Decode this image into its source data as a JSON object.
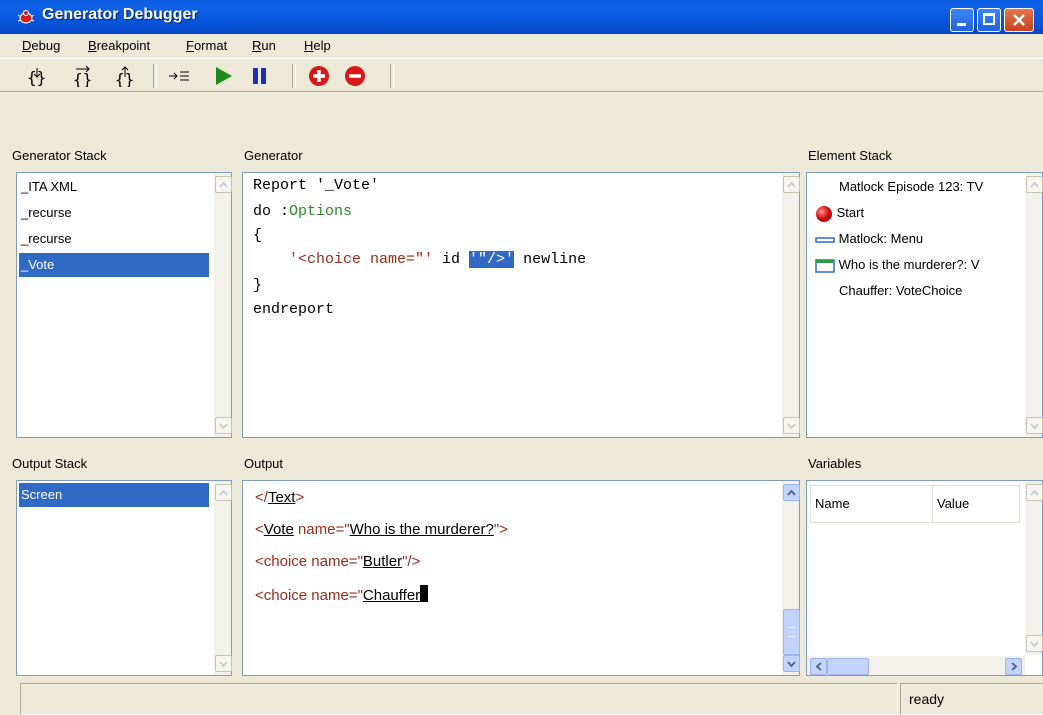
{
  "window": {
    "title": "Generator Debugger"
  },
  "menu": [
    "Debug",
    "Breakpoint",
    "Format",
    "Run",
    "Help"
  ],
  "toolbar": {
    "buttons": [
      "step-into-icon",
      "step-over-icon",
      "step-out-icon",
      "run-to-cursor-icon",
      "run-icon",
      "pause-icon",
      "add-breakpoint-icon",
      "remove-breakpoint-icon"
    ]
  },
  "generator_stack": {
    "label": "Generator Stack",
    "items": [
      "_ITA XML",
      "_recurse",
      "_recurse",
      "_Vote"
    ],
    "selected": "_Vote"
  },
  "generator": {
    "label": "Generator",
    "lines": {
      "l1": "Report '_Vote'",
      "l2a": "do :",
      "l2b": "Options",
      "l3": "{",
      "l4a": "'<choice name=\"'",
      "l4b": " id ",
      "l4c": "'\"/>'",
      "l4d": " newline",
      "l5": "}",
      "l6": "endreport"
    }
  },
  "element_stack": {
    "label": "Element Stack",
    "items": [
      "Matlock Episode 123: TV",
      "Start",
      "Matlock: Menu",
      "Who is the murderer?: V",
      "Chauffer: VoteChoice"
    ]
  },
  "output_stack": {
    "label": "Output Stack",
    "items": [
      "Screen"
    ],
    "selected": "Screen"
  },
  "output": {
    "label": "Output",
    "l1a": "</",
    "l1b": "Text",
    "l1c": ">",
    "l2a": "<",
    "l2b": "Vote",
    "l2c": " name=\"",
    "l2d": "Who is the murderer?",
    "l2e": "\">",
    "l3a": "<choice name=\"",
    "l3b": "Butler",
    "l3c": "\"/>",
    "l4a": "<choice name=\"",
    "l4b": "Chauffer"
  },
  "variables": {
    "label": "Variables",
    "columns": [
      "Name",
      "Value"
    ]
  },
  "status": {
    "text": "ready"
  }
}
